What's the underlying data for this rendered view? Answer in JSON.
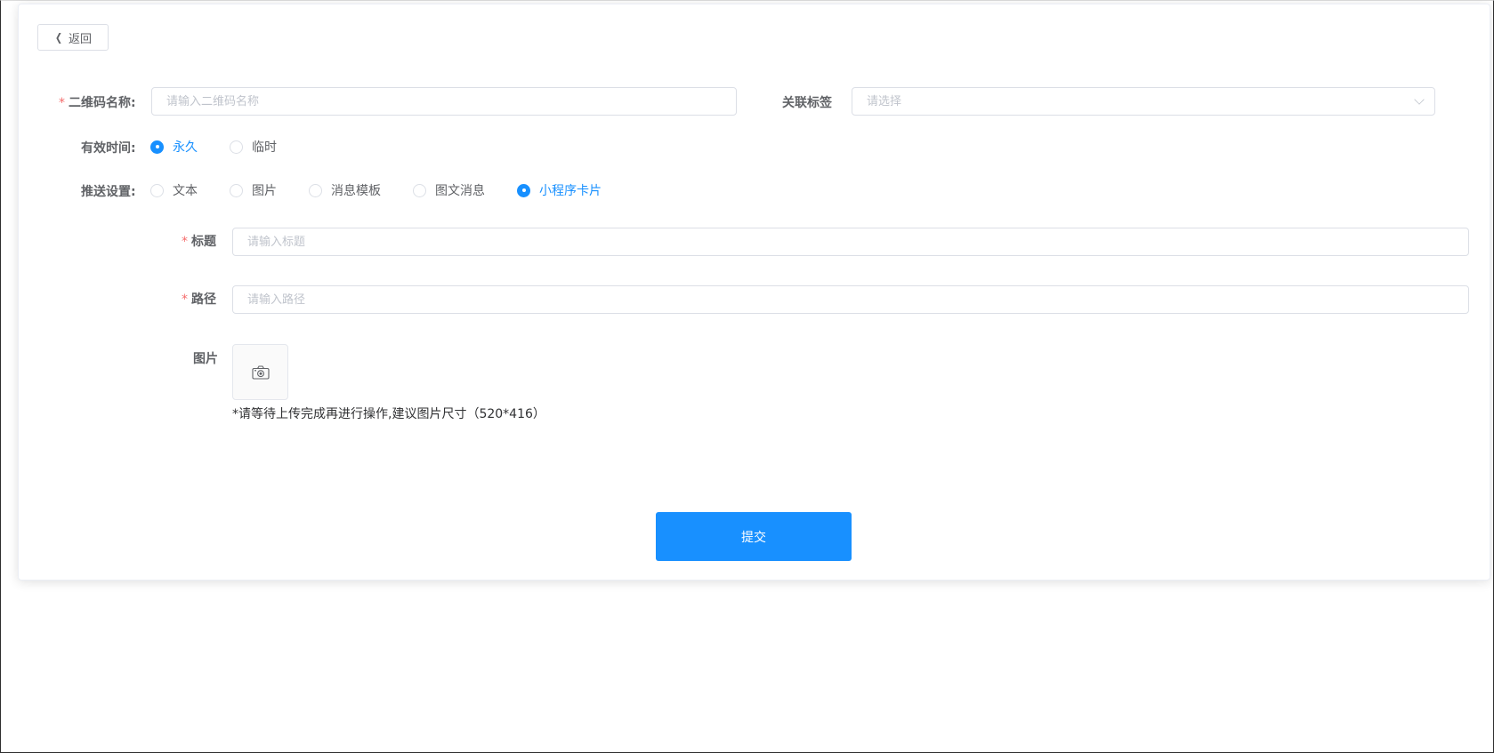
{
  "back_button": {
    "label": "返回",
    "icon": "chevron-left-icon"
  },
  "form": {
    "qr_name": {
      "label": "二维码名称:",
      "required_mark": "*",
      "placeholder": "请输入二维码名称",
      "value": ""
    },
    "tag": {
      "label": "关联标签",
      "placeholder": "请选择",
      "value": ""
    },
    "valid_time": {
      "label": "有效时间:",
      "options": [
        "永久",
        "临时"
      ],
      "selected": "永久"
    },
    "push_setting": {
      "label": "推送设置:",
      "options": [
        "文本",
        "图片",
        "消息模板",
        "图文消息",
        "小程序卡片"
      ],
      "selected": "小程序卡片"
    },
    "title": {
      "label": "标题",
      "required_mark": "*",
      "placeholder": "请输入标题",
      "value": ""
    },
    "path": {
      "label": "路径",
      "required_mark": "*",
      "placeholder": "请输入路径",
      "value": ""
    },
    "image": {
      "label": "图片",
      "upload_icon": "camera-icon",
      "hint": "*请等待上传完成再进行操作,建议图片尺寸（520*416）"
    }
  },
  "submit_button": {
    "label": "提交"
  },
  "colors": {
    "primary": "#1890ff",
    "required": "#f56c6c",
    "border": "#dcdfe6"
  }
}
